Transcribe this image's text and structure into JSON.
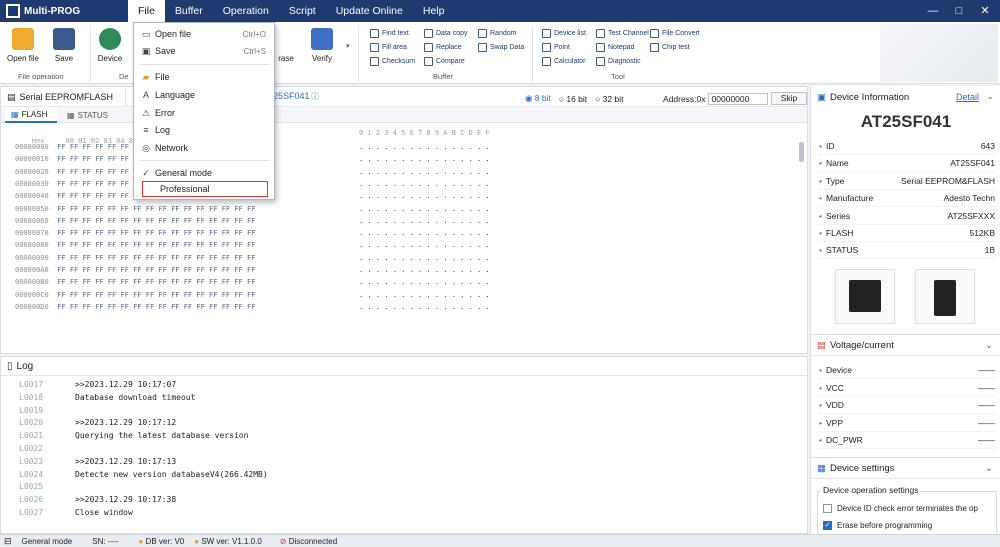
{
  "app": {
    "title": "Multi-PROG"
  },
  "menu": [
    "File",
    "Buffer",
    "Operation",
    "Script",
    "Update Online",
    "Help"
  ],
  "window_controls": [
    "—",
    "□",
    "✕"
  ],
  "ribbon": {
    "file_op": {
      "label": "File operation",
      "buttons": [
        "Open file",
        "Save"
      ]
    },
    "device_btn": "Device",
    "dev_group_partial": "De",
    "erase_partial": "rase",
    "verify": "Verify",
    "buffer": {
      "label": "Buffer",
      "items": [
        "Find text",
        "Fill area",
        "Checksum",
        "Data copy",
        "Replace",
        "Compare",
        "Random",
        "Swap Data"
      ]
    },
    "tool": {
      "label": "Tool",
      "items": [
        "Device list",
        "Point",
        "Calculator",
        "Test Channel",
        "Notepad",
        "Diagnostic",
        "File Convert",
        "Chip test"
      ]
    }
  },
  "file_menu": {
    "items": [
      {
        "label": "Open file",
        "shortcut": "Ctrl+O",
        "icon": "open-file-icon"
      },
      {
        "label": "Save",
        "shortcut": "Ctrl+S",
        "icon": "save-icon"
      },
      {
        "label": "File",
        "icon": "folder-icon"
      },
      {
        "label": "Language",
        "icon": "language-icon"
      },
      {
        "label": "Error",
        "icon": "error-icon"
      },
      {
        "label": "Log",
        "icon": "log-icon"
      },
      {
        "label": "Network",
        "icon": "network-icon"
      }
    ],
    "modes": [
      "General mode",
      "Professional"
    ]
  },
  "editor": {
    "tab": "Serial EEPROMFLASH",
    "tab_chip": "25SF041",
    "subtabs": [
      "FLASH",
      "STATUS"
    ],
    "bit_options": [
      "8 bit",
      "16 bit",
      "32 bit"
    ],
    "address_label": "Address:0x",
    "address_value": "00000000",
    "skip": "Skip",
    "hex_header": "Hex     00 01 02 03 04 05 06 07 08 09 0A 0B 0C 0D 0E 0F",
    "ascii_header": "0 1 2 3 4 5 6 7 8 9 A B C D E F",
    "addresses": [
      "00000000",
      "00000010",
      "00000020",
      "00000030",
      "00000040",
      "00000050",
      "00000060",
      "00000070",
      "00000080",
      "00000090",
      "000000A0",
      "000000B0",
      "000000C0",
      "000000D0"
    ],
    "byte_value": "FF"
  },
  "log": {
    "title": "Log",
    "lines": [
      {
        "n": "L0017",
        "t": ">>2023.12.29 10:17:07"
      },
      {
        "n": "L0018",
        "t": "Database download timeout"
      },
      {
        "n": "L0019",
        "t": ""
      },
      {
        "n": "L0020",
        "t": ">>2023.12.29 10:17:12"
      },
      {
        "n": "L0021",
        "t": "Querying the latest database version"
      },
      {
        "n": "L0022",
        "t": ""
      },
      {
        "n": "L0023",
        "t": ">>2023.12.29 10:17:13"
      },
      {
        "n": "L0024",
        "t": "Detecte new version databaseV4(266.42MB)"
      },
      {
        "n": "L0025",
        "t": ""
      },
      {
        "n": "L0026",
        "t": ">>2023.12.29 10:17:38"
      },
      {
        "n": "L0027",
        "t": "Close window"
      }
    ]
  },
  "device_info": {
    "title": "Device Information",
    "detail": "Detail",
    "chip": "AT25SF041",
    "rows": [
      {
        "k": "ID",
        "v": "643"
      },
      {
        "k": "Name",
        "v": "AT25SF041"
      },
      {
        "k": "Type",
        "v": "Serial EEPROM&FLASH"
      },
      {
        "k": "Manufacture",
        "v": "Adesto Techn"
      },
      {
        "k": "Series",
        "v": "AT25SFXXX"
      },
      {
        "k": "FLASH",
        "v": "512KB"
      },
      {
        "k": "STATUS",
        "v": "1B"
      }
    ]
  },
  "voltage": {
    "title": "Voltage/current",
    "rows": [
      {
        "k": "Device",
        "v": "——"
      },
      {
        "k": "VCC",
        "v": "——"
      },
      {
        "k": "VDD",
        "v": "——"
      },
      {
        "k": "VPP",
        "v": "——"
      },
      {
        "k": "DC_PWR",
        "v": "——"
      }
    ]
  },
  "device_settings": {
    "title": "Device settings",
    "group": "Device operation settings",
    "options": [
      {
        "label": "Device ID check error terminates the op",
        "checked": false
      },
      {
        "label": "Erase before programming",
        "checked": true
      }
    ]
  },
  "status": {
    "mode": "General mode",
    "sn": "SN:  ----",
    "db": "DB ver: V0",
    "sw": "SW ver: V1.1.0.0",
    "conn": "Disconnected"
  },
  "colors": {
    "menubar": "#1f3a6e",
    "accent": "#2a6dc9",
    "highlight": "#e03030",
    "bullet": "#3c9a3c"
  }
}
